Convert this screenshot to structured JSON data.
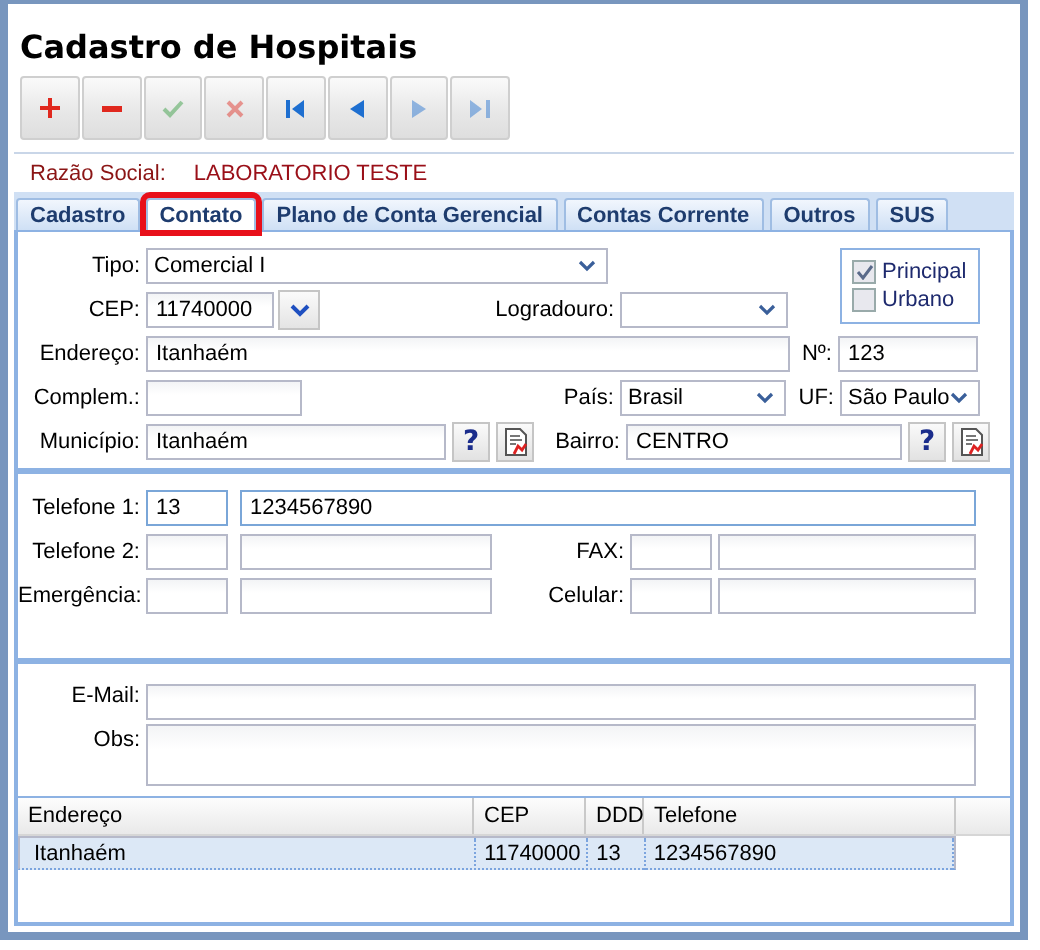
{
  "window": {
    "title": "Cadastro de Hospitais"
  },
  "toolbar": [
    {
      "kind": "add",
      "disabled": false
    },
    {
      "kind": "remove",
      "disabled": false
    },
    {
      "kind": "confirm",
      "disabled": true
    },
    {
      "kind": "cancel",
      "disabled": true
    },
    {
      "kind": "first",
      "disabled": false
    },
    {
      "kind": "previous",
      "disabled": false
    },
    {
      "kind": "next",
      "disabled": true
    },
    {
      "kind": "last",
      "disabled": true
    }
  ],
  "razao_social": {
    "label": "Razão Social:",
    "value": "LABORATORIO TESTE"
  },
  "tabs": [
    {
      "label": "Cadastro",
      "selected": false,
      "highlighted": false
    },
    {
      "label": "Contato",
      "selected": true,
      "highlighted": true
    },
    {
      "label": "Plano de Conta Gerencial",
      "selected": false,
      "highlighted": false
    },
    {
      "label": "Contas Corrente",
      "selected": false,
      "highlighted": false
    },
    {
      "label": "Outros",
      "selected": false,
      "highlighted": false
    },
    {
      "label": "SUS",
      "selected": false,
      "highlighted": false
    }
  ],
  "address": {
    "tipo": {
      "label": "Tipo:",
      "value": "Comercial I"
    },
    "cep": {
      "label": "CEP:",
      "value": "11740000"
    },
    "logradouro": {
      "label": "Logradouro:"
    },
    "flags": [
      {
        "label": "Principal",
        "checked": true
      },
      {
        "label": "Urbano",
        "checked": false
      }
    ],
    "endereco": {
      "label": "Endereço:",
      "value": "Itanhaém"
    },
    "numero": {
      "label": "Nº:",
      "value": "123"
    },
    "complemento": {
      "label": "Complem.:"
    },
    "pais": {
      "label": "País:",
      "value": "Brasil"
    },
    "uf": {
      "label": "UF:",
      "value": "São Paulo"
    },
    "municipio": {
      "label": "Município:",
      "value": "Itanhaém",
      "help": "?"
    },
    "bairro": {
      "label": "Bairro:",
      "value": "CENTRO",
      "help": "?"
    }
  },
  "phones": {
    "telefone_1": {
      "label": "Telefone 1:",
      "ddd": "13",
      "number": "1234567890",
      "focused": true
    },
    "telefone_2": {
      "label": "Telefone 2:",
      "focused": false
    },
    "fax": {
      "label": "FAX:",
      "focused": false
    },
    "emergencia": {
      "label": "Emergência:",
      "focused": false
    },
    "celular": {
      "label": "Celular:",
      "focused": false
    }
  },
  "contact": {
    "email": {
      "label": "E-Mail:"
    },
    "obs": {
      "label": "Obs:"
    }
  },
  "table": {
    "columns": [
      "Endereço",
      "CEP",
      "DDD",
      "Telefone"
    ],
    "rows": [
      {
        "cells": [
          "Itanhaém",
          "11740000",
          "13",
          "1234567890"
        ],
        "selected": true
      }
    ]
  }
}
